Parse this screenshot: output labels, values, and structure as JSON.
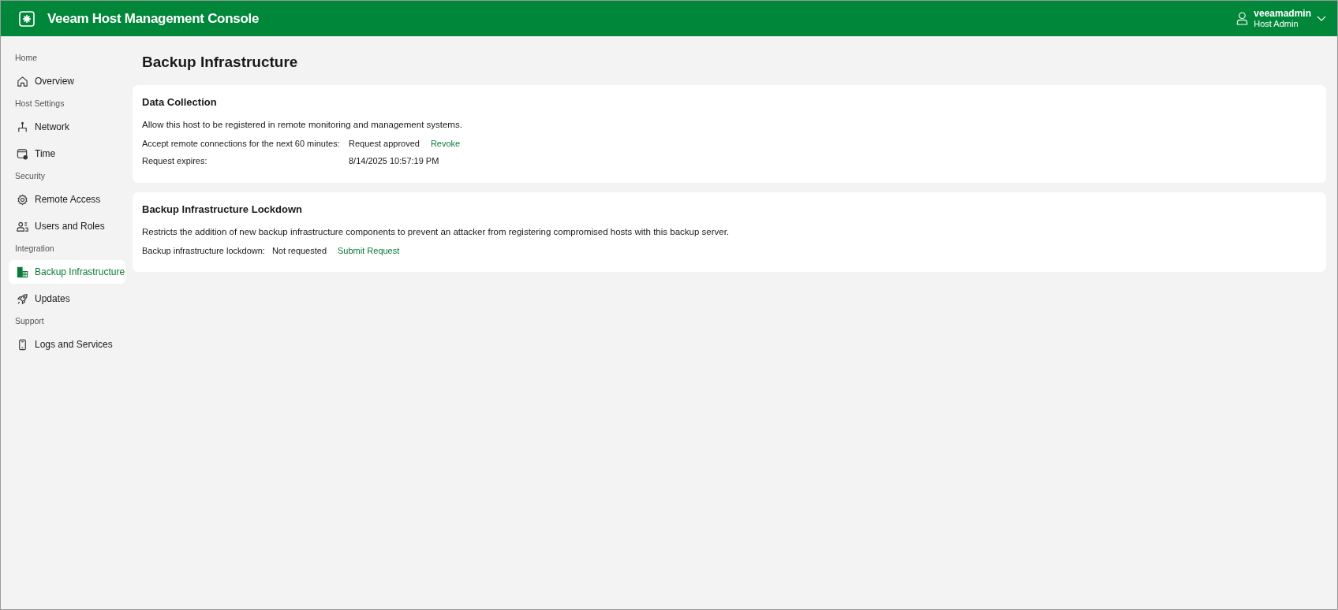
{
  "header": {
    "title": "Veeam Host Management Console",
    "user": {
      "name": "veeamadmin",
      "role": "Host Admin"
    }
  },
  "sidebar": {
    "groups": [
      {
        "label": "Home",
        "items": [
          {
            "label": "Overview",
            "selected": false
          }
        ]
      },
      {
        "label": "Host Settings",
        "items": [
          {
            "label": "Network",
            "selected": false
          },
          {
            "label": "Time",
            "selected": false
          }
        ]
      },
      {
        "label": "Security",
        "items": [
          {
            "label": "Remote Access",
            "selected": false
          },
          {
            "label": "Users and Roles",
            "selected": false
          }
        ]
      },
      {
        "label": "Integration",
        "items": [
          {
            "label": "Backup Infrastructure",
            "selected": true
          },
          {
            "label": "Updates",
            "selected": false
          }
        ]
      },
      {
        "label": "Support",
        "items": [
          {
            "label": "Logs and Services",
            "selected": false
          }
        ]
      }
    ]
  },
  "page": {
    "title": "Backup Infrastructure",
    "cards": [
      {
        "title": "Data Collection",
        "description": "Allow this host to be registered in remote monitoring and management systems.",
        "kind": "grid",
        "rows": [
          {
            "label": "Accept remote connections for the next 60 minutes:",
            "value": "Request approved",
            "link": "Revoke"
          },
          {
            "label": "Request expires:",
            "value": "8/14/2025 10:57:19 PM"
          }
        ]
      },
      {
        "title": "Backup Infrastructure Lockdown",
        "description": "Restricts the addition of new backup infrastructure components to prevent an attacker from registering compromised hosts with this backup server.",
        "kind": "inline",
        "rows": [
          {
            "label": "Backup infrastructure lockdown:",
            "value": "Not requested",
            "link": "Submit Request"
          }
        ]
      }
    ]
  }
}
